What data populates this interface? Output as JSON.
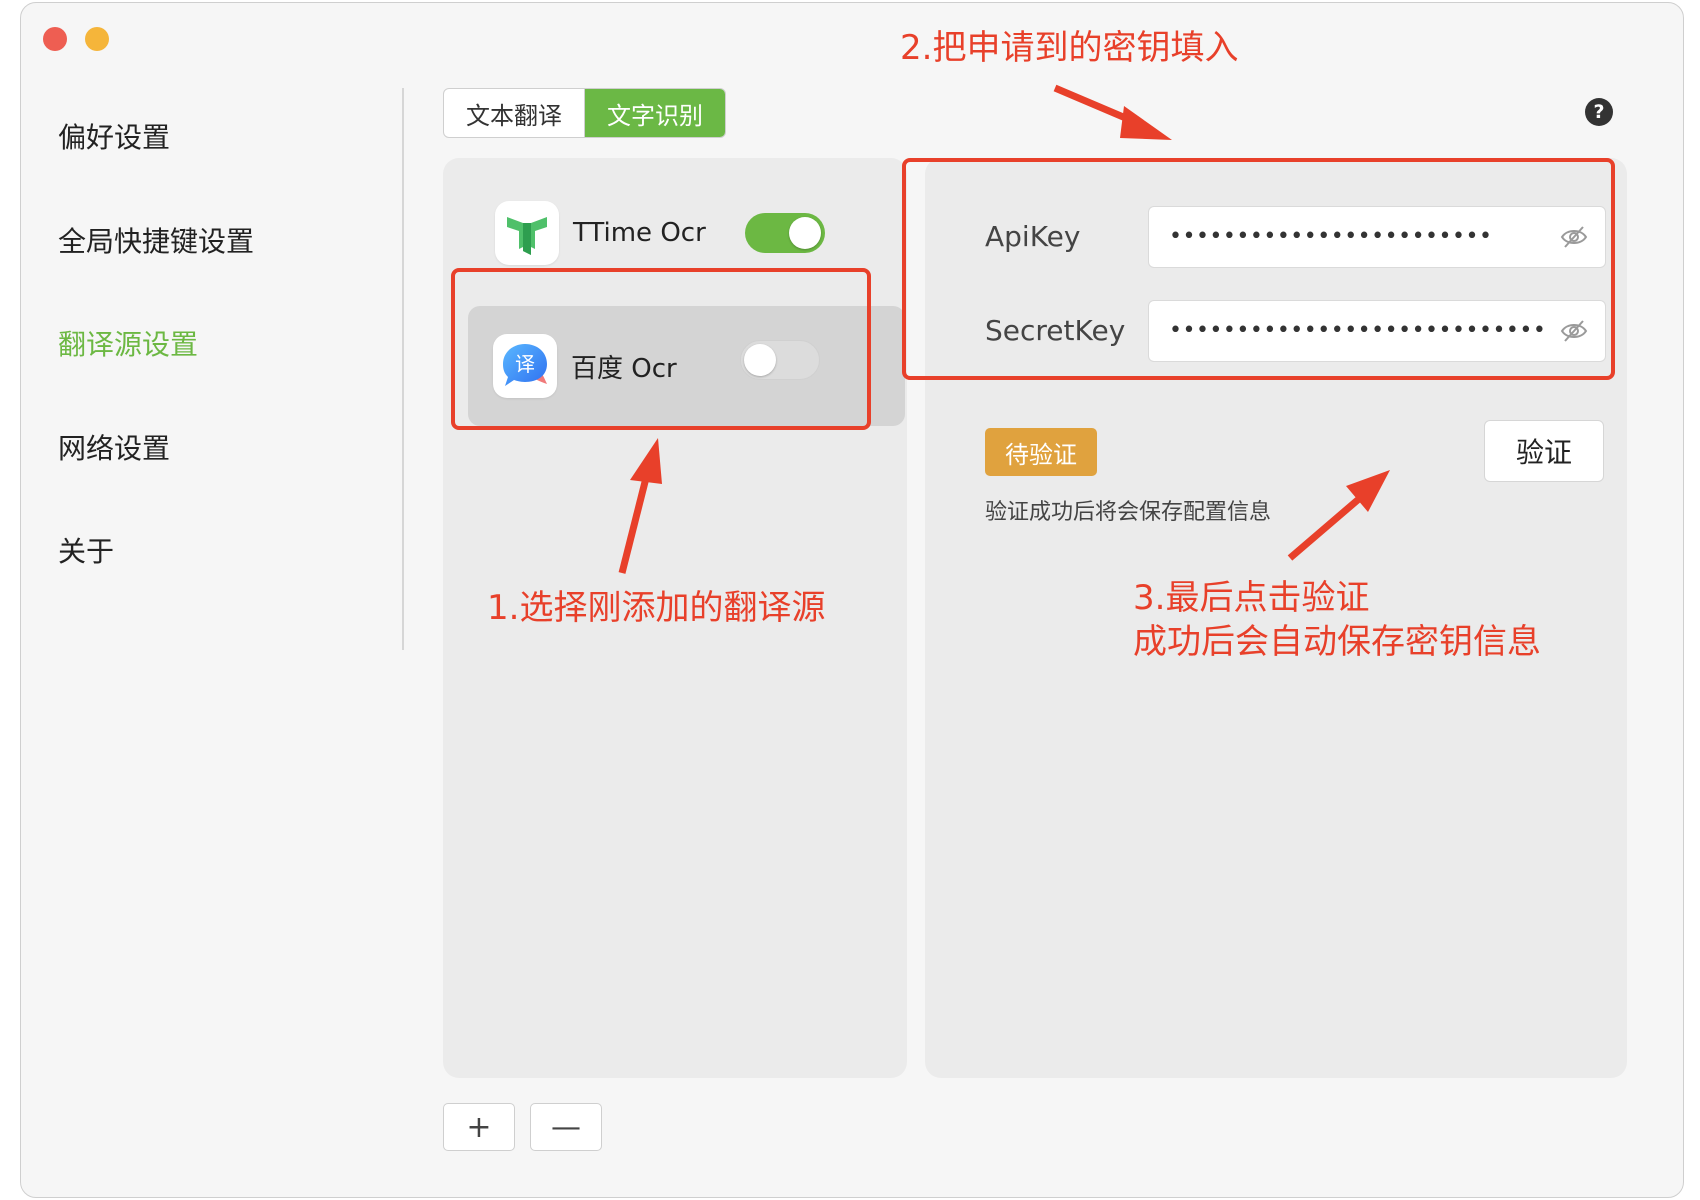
{
  "window": {
    "controls": [
      "close",
      "minimize"
    ]
  },
  "sidebar": {
    "items": [
      {
        "label": "偏好设置",
        "active": false
      },
      {
        "label": "全局快捷键设置",
        "active": false
      },
      {
        "label": "翻译源设置",
        "active": true
      },
      {
        "label": "网络设置",
        "active": false
      },
      {
        "label": "关于",
        "active": false
      }
    ]
  },
  "tabs": [
    {
      "label": "文本翻译",
      "active": false
    },
    {
      "label": "文字识别",
      "active": true
    }
  ],
  "help": {
    "icon": "help-icon",
    "label": "?"
  },
  "sources": [
    {
      "name": "TTime Ocr",
      "icon": "ttime-logo-icon",
      "enabled": true,
      "selected": false
    },
    {
      "name": "百度 Ocr",
      "icon": "baidu-translate-icon",
      "enabled": false,
      "selected": true
    }
  ],
  "source_actions": {
    "add_label": "+",
    "remove_label": "—"
  },
  "config": {
    "api_key_label": "ApiKey",
    "api_key_value": "••••••••••••••••••••••••",
    "secret_key_label": "SecretKey",
    "secret_key_value": "••••••••••••••••••••••••••••••••",
    "status_badge": "待验证",
    "verify_label": "验证",
    "hint": "验证成功后将会保存配置信息"
  },
  "annotations": {
    "step1": "1.选择刚添加的翻译源",
    "step2": "2.把申请到的密钥填入",
    "step3_line1": "3.最后点击验证",
    "step3_line2": "成功后会自动保存密钥信息"
  },
  "colors": {
    "accent_green": "#6cb843",
    "annotation_red": "#e8402a",
    "badge_orange": "#e0a23e",
    "traffic_red": "#ee5e52",
    "traffic_yellow": "#f5b53a"
  }
}
